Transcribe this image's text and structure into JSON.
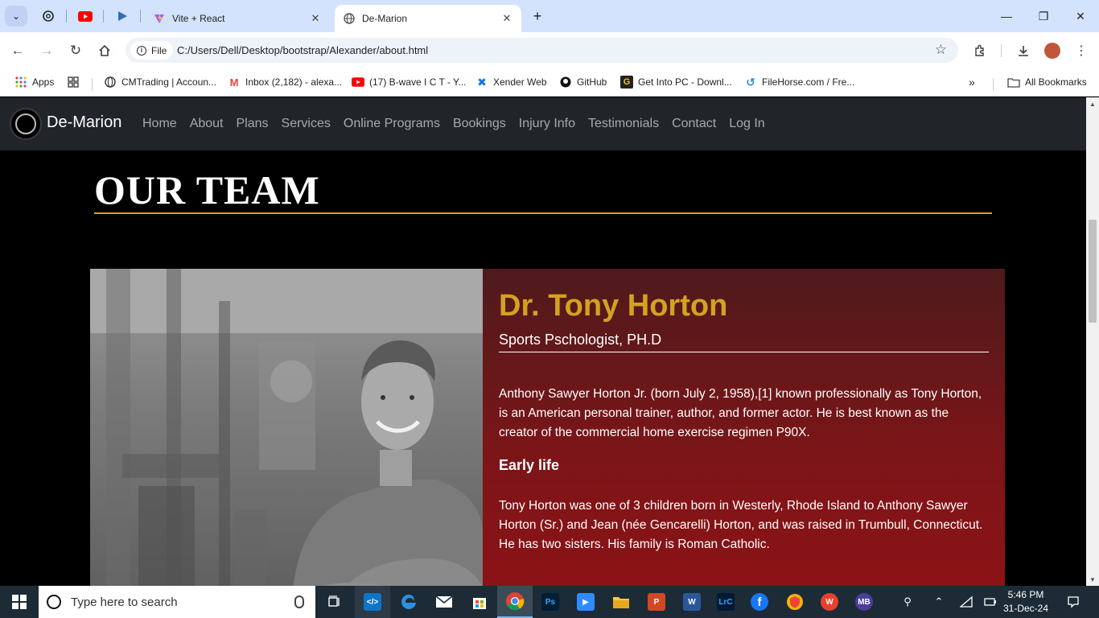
{
  "browser": {
    "tabs": [
      {
        "title": "Vite + React",
        "active": false
      },
      {
        "title": "De-Marion",
        "active": true
      }
    ],
    "url_chip": "File",
    "url": "C:/Users/Dell/Desktop/bootstrap/Alexander/about.html",
    "bookmarks": [
      {
        "label": "Apps"
      },
      {
        "label": "CMTrading | Accoun..."
      },
      {
        "label": "Inbox (2,182) - alexa..."
      },
      {
        "label": "(17) B-wave I C T - Y..."
      },
      {
        "label": "Xender Web"
      },
      {
        "label": "GitHub"
      },
      {
        "label": "Get Into PC - Downl..."
      },
      {
        "label": "FileHorse.com / Fre..."
      },
      {
        "label": "All Bookmarks"
      }
    ]
  },
  "site": {
    "brand": "De-Marion",
    "nav": [
      "Home",
      "About",
      "Plans",
      "Services",
      "Online Programs",
      "Bookings",
      "Injury Info",
      "Testimonials",
      "Contact",
      "Log In"
    ],
    "heading": "OUR TEAM",
    "member": {
      "name": "Dr. Tony Horton",
      "role": "Sports Pschologist, PH.D",
      "intro": "Anthony Sawyer Horton Jr. (born July 2, 1958),[1] known professionally as Tony Horton, is an American personal trainer, author, and former actor. He is best known as the creator of the commercial home exercise regimen P90X.",
      "section_title": "Early life",
      "early_life": "Tony Horton was one of 3 children born in Westerly, Rhode Island to Anthony Sawyer Horton (Sr.) and Jean (née Gencarelli) Horton, and was raised in Trumbull, Connecticut. He has two sisters. His family is Roman Catholic."
    },
    "colors": {
      "accent": "#d4a21f",
      "navbar": "#212529",
      "card": "#7c1518"
    }
  },
  "taskbar": {
    "search_placeholder": "Type here to search",
    "time": "5:46 PM",
    "date": "31-Dec-24"
  }
}
